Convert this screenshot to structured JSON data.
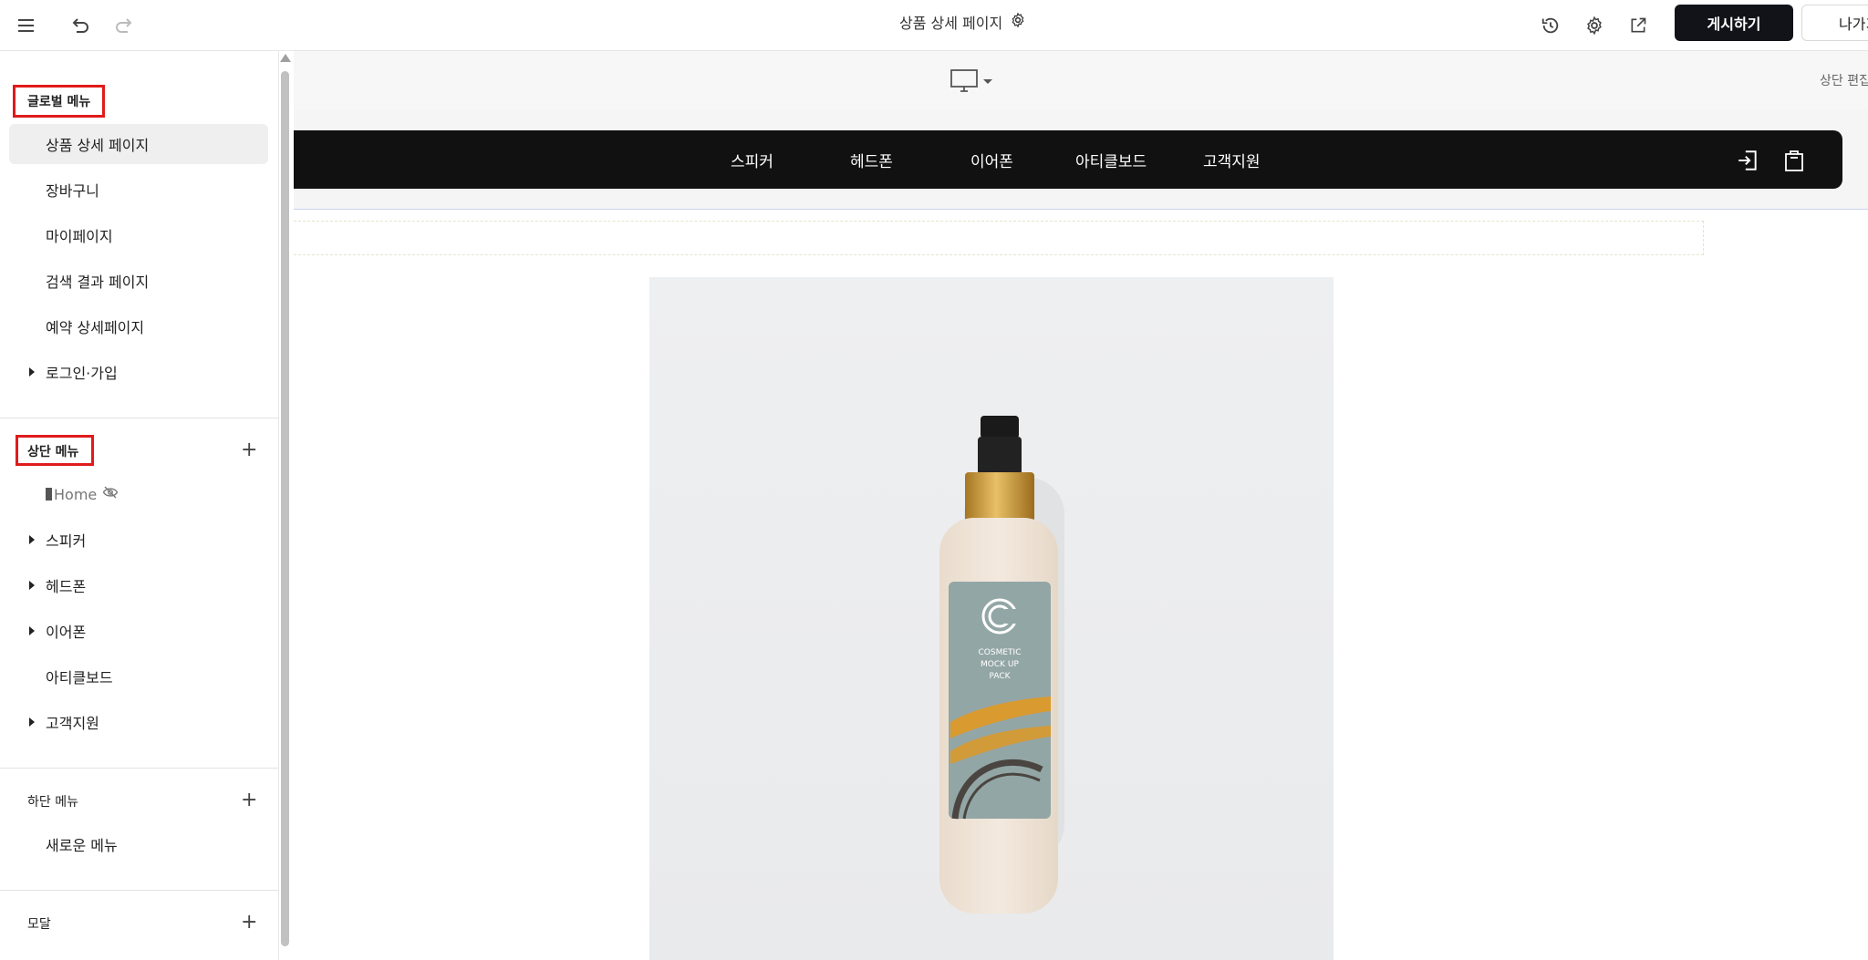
{
  "app": {
    "page_title": "상품 상세 페이지",
    "publish_label": "게시하기",
    "exit_label": "나가기"
  },
  "sidebar": {
    "global_menu": {
      "title": "글로벌 메뉴",
      "items": [
        {
          "label": "상품 상세 페이지",
          "active": true,
          "expandable": false
        },
        {
          "label": "장바구니",
          "active": false,
          "expandable": false
        },
        {
          "label": "마이페이지",
          "active": false,
          "expandable": false
        },
        {
          "label": "검색 결과 페이지",
          "active": false,
          "expandable": false
        },
        {
          "label": "예약 상세페이지",
          "active": false,
          "expandable": false
        },
        {
          "label": "로그인·가입",
          "active": false,
          "expandable": true
        }
      ]
    },
    "top_menu": {
      "title": "상단 메뉴",
      "items": [
        {
          "label": "Home",
          "hidden": true,
          "expandable": false
        },
        {
          "label": "스피커",
          "expandable": true
        },
        {
          "label": "헤드폰",
          "expandable": true
        },
        {
          "label": "이어폰",
          "expandable": true
        },
        {
          "label": "아티클보드",
          "expandable": false
        },
        {
          "label": "고객지원",
          "expandable": true
        }
      ]
    },
    "bottom_menu": {
      "title": "하단 메뉴",
      "items": [
        {
          "label": "새로운 메뉴"
        }
      ]
    },
    "modal": {
      "title": "모달"
    }
  },
  "canvas": {
    "top_edit_label": "상단 편집",
    "site_nav": [
      "스피커",
      "헤드폰",
      "이어폰",
      "아티클보드",
      "고객지원"
    ],
    "product_label": [
      "COSMETIC",
      "MOCK UP",
      "PACK"
    ]
  },
  "colors": {
    "accent_dark": "#111318",
    "highlight_red": "#e01b1b",
    "active_bg": "#efefef"
  }
}
